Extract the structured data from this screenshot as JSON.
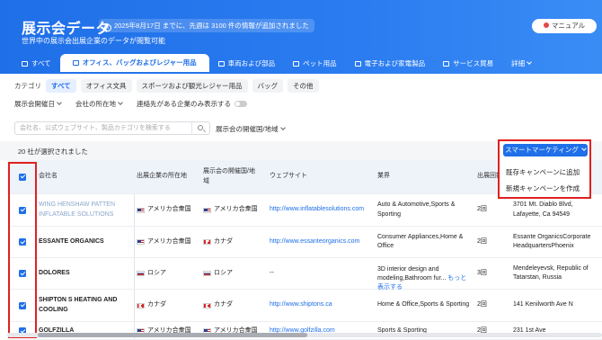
{
  "header": {
    "title": "展示会データ",
    "notice": "2025年8月17日 までに、先週は 3100 件の情報が追加されました",
    "subtitle": "世界中の展示会出展企業のデータが閲覧可能",
    "manual_label": "マニュアル"
  },
  "tabs": [
    {
      "label": "すべて",
      "icon": "grid-icon"
    },
    {
      "label": "オフィス、バッグおよびレジャー用品",
      "icon": "bag-icon",
      "active": true
    },
    {
      "label": "車両および部品",
      "icon": "car-icon"
    },
    {
      "label": "ペット用品",
      "icon": "pet-icon"
    },
    {
      "label": "電子および家電製品",
      "icon": "device-icon"
    },
    {
      "label": "サービス貿易",
      "icon": "globe-icon"
    },
    {
      "label": "詳細",
      "icon": "chevron-down-icon"
    }
  ],
  "category": {
    "label": "カテゴリ",
    "chips": [
      "すべて",
      "オフィス文具",
      "スポーツおよび観光レジャー用品",
      "バッグ",
      "その他"
    ]
  },
  "filters": {
    "date": "展示会開催日",
    "location": "会社の所在地",
    "contact_only": "連絡先がある企業のみ表示する"
  },
  "search": {
    "placeholder": "会社名、公式ウェブサイト、製品カテゴリを検索する",
    "region": "展示会の開催国/地域"
  },
  "selection": {
    "count_text": "20 社が選択されました"
  },
  "smart_marketing": {
    "button": "スマートマーケティング",
    "items": [
      "既存キャンペーンに追加",
      "新規キャンペーンを作成"
    ]
  },
  "table": {
    "headers": [
      "会社名",
      "出展企業の所在地",
      "展示会の開催国/地域",
      "ウェブサイト",
      "業界",
      "出展回数",
      ""
    ],
    "rows": [
      {
        "company": "WING HENSHAW PATTEN INFLATABLE SOLUTIONS",
        "faded": true,
        "location": "アメリカ合衆国",
        "loc_flag": "us",
        "country": "アメリカ合衆国",
        "country_flag": "us",
        "website": "http://www.inflatablesolutions.com",
        "industry": "Auto & Automotive,Sports & Sporting",
        "count": "2回",
        "address": "3701 Mt. Diablo Blvd, Lafayette, Ca 94549"
      },
      {
        "company": "ESSANTE ORGANICS",
        "location": "アメリカ合衆国",
        "loc_flag": "us",
        "country": "カナダ",
        "country_flag": "ca",
        "website": "http://www.essanteorganics.com",
        "industry": "Consumer Appliances,Home & Office",
        "count": "2回",
        "address": "Essante OrganicsCorporate HeadquartersPhoenix"
      },
      {
        "company": "DOLORES",
        "location": "ロシア",
        "loc_flag": "ru",
        "country": "ロシア",
        "country_flag": "ru",
        "website": "--",
        "industry": "3D interior design and modeling,Bathroom fur...",
        "more": "もっと表示する",
        "count": "3回",
        "address": "Mendeleyevsk, Republic of Tatarstan, Russia"
      },
      {
        "company": "SHIPTON S HEATING AND COOLING",
        "location": "カナダ",
        "loc_flag": "ca",
        "country": "カナダ",
        "country_flag": "ca",
        "website": "http://www.shiptons.ca",
        "industry": "Home & Office,Sports & Sporting",
        "count": "2回",
        "address": "141 Kenilworth Ave N"
      },
      {
        "company": "GOLFZILLA",
        "location": "アメリカ合衆国",
        "loc_flag": "us",
        "country": "アメリカ合衆国",
        "country_flag": "us",
        "website": "http://www.golfzilla.com",
        "industry": "Sports & Sporting",
        "count": "2回",
        "address": "231 1st Ave"
      }
    ]
  },
  "colors": {
    "brand": "#1f6fe8",
    "highlight": "#e02020"
  }
}
